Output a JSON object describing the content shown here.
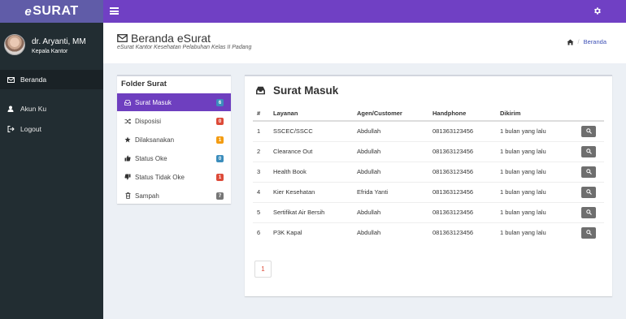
{
  "app": {
    "logo_prefix": "e",
    "logo_main": "SURAT"
  },
  "user": {
    "name": "dr. Aryanti, MM",
    "role": "Kepala Kantor"
  },
  "sidebar": {
    "items": [
      {
        "label": "Beranda",
        "icon": "envelope-icon",
        "active": true
      },
      {
        "label": "Akun Ku",
        "icon": "user-icon",
        "active": false
      },
      {
        "label": "Logout",
        "icon": "sign-out-icon",
        "active": false
      }
    ]
  },
  "header": {
    "title": "Beranda eSurat",
    "subtitle": "eSurat Kantor Kesehatan Pelabuhan Kelas II Padang",
    "breadcrumb_sep": "/",
    "breadcrumb_current": "Beranda"
  },
  "folders": {
    "title": "Folder Surat",
    "items": [
      {
        "label": "Surat Masuk",
        "icon": "inbox-icon",
        "count": "6",
        "badge_color": "#3c8dbc",
        "active": true
      },
      {
        "label": "Disposisi",
        "icon": "random-icon",
        "count": "0",
        "badge_color": "#dd4b39",
        "active": false
      },
      {
        "label": "Dilaksanakan",
        "icon": "star-icon",
        "count": "1",
        "badge_color": "#f39c12",
        "active": false
      },
      {
        "label": "Status Oke",
        "icon": "thumbs-up-icon",
        "count": "0",
        "badge_color": "#3c8dbc",
        "active": false
      },
      {
        "label": "Status Tidak Oke",
        "icon": "thumbs-down-icon",
        "count": "1",
        "badge_color": "#dd4b39",
        "active": false
      },
      {
        "label": "Sampah",
        "icon": "trash-icon",
        "count": "7",
        "badge_color": "#777777",
        "active": false
      }
    ]
  },
  "inbox": {
    "title": "Surat Masuk",
    "columns": [
      "#",
      "Layanan",
      "Agen/Customer",
      "Handphone",
      "Dikirim"
    ],
    "rows": [
      [
        "1",
        "SSCEC/SSCC",
        "Abdullah",
        "081363123456",
        "1 bulan yang lalu"
      ],
      [
        "2",
        "Clearance Out",
        "Abdullah",
        "081363123456",
        "1 bulan yang lalu"
      ],
      [
        "3",
        "Health Book",
        "Abdullah",
        "081363123456",
        "1 bulan yang lalu"
      ],
      [
        "4",
        "Kier Kesehatan",
        "Efrida Yanti",
        "081363123456",
        "1 bulan yang lalu"
      ],
      [
        "5",
        "Sertifikat Air Bersih",
        "Abdullah",
        "081363123456",
        "1 bulan yang lalu"
      ],
      [
        "6",
        "P3K Kapal",
        "Abdullah",
        "081363123456",
        "1 bulan yang lalu"
      ]
    ],
    "page": "1"
  },
  "colors": {
    "navbar": "#7040c4",
    "logo_bg": "#605ca8",
    "sidebar": "#222d32",
    "active_folder": "#6e3fbf"
  }
}
